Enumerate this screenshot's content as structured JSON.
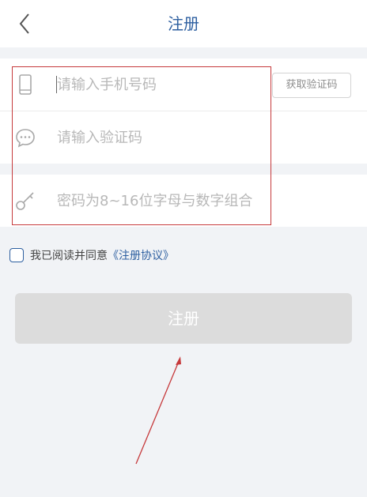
{
  "nav": {
    "title": "注册",
    "back_icon": "chevron-left-icon"
  },
  "form": {
    "phone": {
      "placeholder": "请输入手机号码",
      "value": "",
      "icon": "phone-icon"
    },
    "code": {
      "placeholder": "请输入验证码",
      "value": "",
      "icon": "chat-bubble-icon",
      "get_code_label": "获取验证码"
    },
    "password": {
      "placeholder": "密码为8~16位字母与数字组合",
      "value": "",
      "icon": "key-icon"
    }
  },
  "agreement": {
    "checked": false,
    "text": "我已阅读并同意",
    "link": "《注册协议》"
  },
  "submit": {
    "label": "注册",
    "enabled": false
  },
  "colors": {
    "accent": "#2d5fa0",
    "annotation": "#c6393b",
    "background": "#f1f3f6",
    "button_disabled": "#dcdcdc"
  }
}
